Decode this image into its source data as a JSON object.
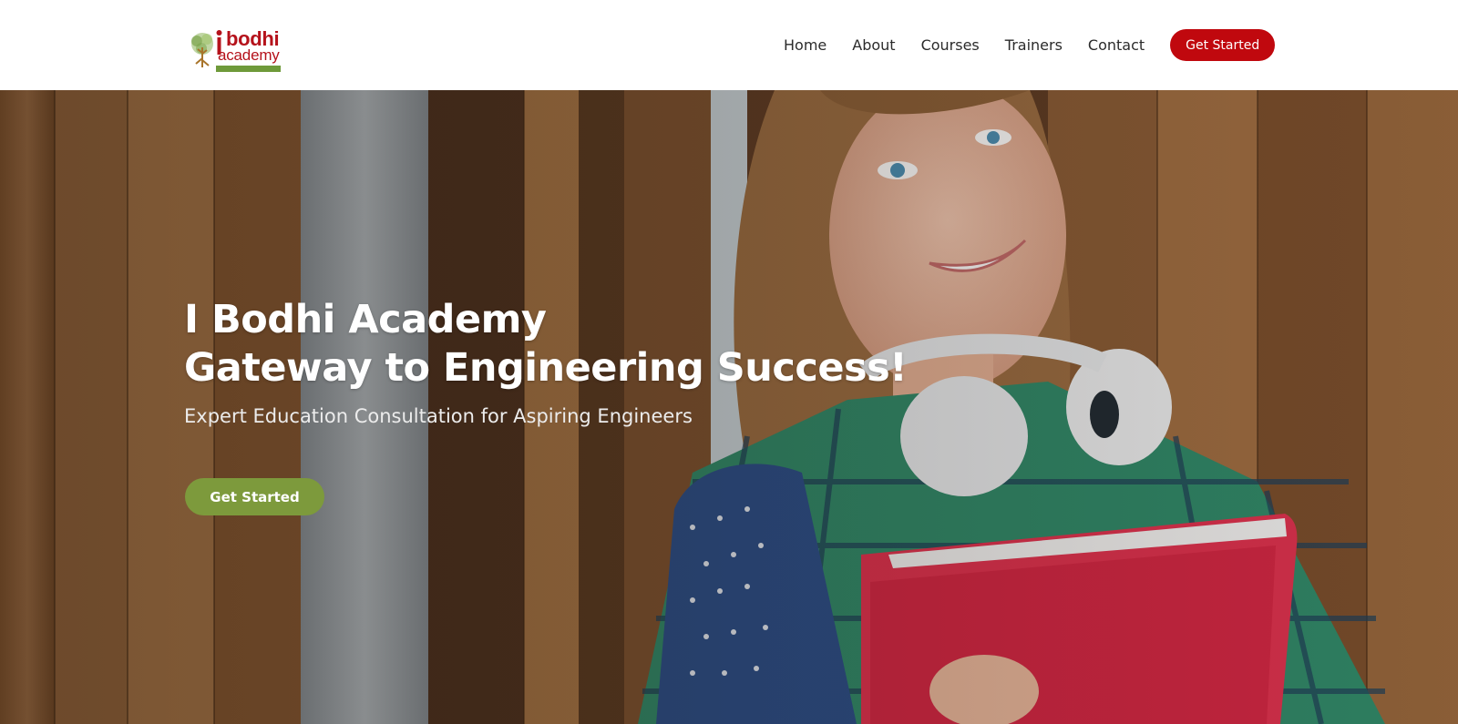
{
  "brand": {
    "logo_word1": "bodhi",
    "logo_word2": "academy",
    "logo_icon": "tree-logo-icon",
    "color_primary": "#b5121b",
    "color_green": "#7d9a3c"
  },
  "nav": {
    "items": [
      "Home",
      "About",
      "Courses",
      "Trainers",
      "Contact"
    ],
    "cta_label": "Get Started"
  },
  "hero": {
    "title_line1": "I Bodhi Academy",
    "title_line2": "Gateway to Engineering Success!",
    "subtitle": "Expert Education Consultation for Aspiring Engineers",
    "cta_label": "Get Started"
  }
}
